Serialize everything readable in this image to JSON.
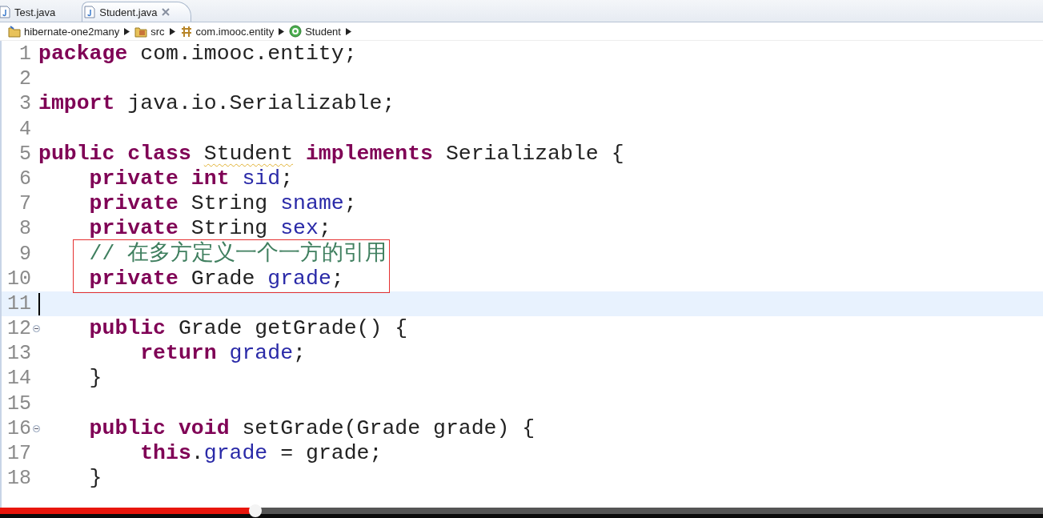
{
  "tabs": [
    {
      "label": "Test.java",
      "selected": false,
      "closable": false
    },
    {
      "label": "Student.java",
      "selected": true,
      "closable": true
    }
  ],
  "breadcrumb": [
    {
      "label": "hibernate-one2many",
      "kind": "project"
    },
    {
      "label": "src",
      "kind": "folder"
    },
    {
      "label": "com.imooc.entity",
      "kind": "package"
    },
    {
      "label": "Student",
      "kind": "class"
    }
  ],
  "code_lines": [
    {
      "number": "1",
      "current": false,
      "boxed": false,
      "fold": false,
      "tokens": [
        {
          "kind": "keyword",
          "text": "package"
        },
        {
          "kind": "plain",
          "text": " com.imooc.entity;"
        }
      ]
    },
    {
      "number": "2",
      "current": false,
      "boxed": false,
      "fold": false
    },
    {
      "number": "3",
      "current": false,
      "boxed": false,
      "fold": false,
      "tokens": [
        {
          "kind": "keyword",
          "text": "import"
        },
        {
          "kind": "plain",
          "text": " java.io.Serializable;"
        }
      ]
    },
    {
      "number": "4",
      "current": false,
      "boxed": false,
      "fold": false
    },
    {
      "number": "5",
      "current": false,
      "boxed": false,
      "fold": false,
      "tokens": [
        {
          "kind": "keyword",
          "text": "public class "
        },
        {
          "kind": "warning",
          "text": "Student"
        },
        {
          "kind": "keyword",
          "text": " implements"
        },
        {
          "kind": "plain",
          "text": " Serializable {"
        }
      ]
    },
    {
      "number": "6",
      "current": false,
      "boxed": false,
      "fold": false,
      "tokens": [
        {
          "kind": "keyword",
          "text": "    private int "
        },
        {
          "kind": "field",
          "text": "sid"
        },
        {
          "kind": "plain",
          "text": ";"
        }
      ]
    },
    {
      "number": "7",
      "current": false,
      "boxed": false,
      "fold": false,
      "tokens": [
        {
          "kind": "keyword",
          "text": "    private"
        },
        {
          "kind": "plain",
          "text": " String "
        },
        {
          "kind": "field",
          "text": "sname"
        },
        {
          "kind": "plain",
          "text": ";"
        }
      ]
    },
    {
      "number": "8",
      "current": false,
      "boxed": false,
      "fold": false,
      "tokens": [
        {
          "kind": "keyword",
          "text": "    private"
        },
        {
          "kind": "plain",
          "text": " String "
        },
        {
          "kind": "field",
          "text": "sex"
        },
        {
          "kind": "plain",
          "text": ";"
        }
      ]
    },
    {
      "number": "9",
      "current": false,
      "boxed": true,
      "fold": false,
      "tokens": [
        {
          "kind": "comment",
          "text": "    // 在多方定义一个一方的引用"
        }
      ]
    },
    {
      "number": "10",
      "current": false,
      "boxed": true,
      "fold": false,
      "tokens": [
        {
          "kind": "keyword",
          "text": "    private"
        },
        {
          "kind": "plain",
          "text": " Grade "
        },
        {
          "kind": "field",
          "text": "grade"
        },
        {
          "kind": "plain",
          "text": ";"
        }
      ]
    },
    {
      "number": "11",
      "current": true,
      "boxed": false,
      "fold": false
    },
    {
      "number": "12",
      "current": false,
      "boxed": false,
      "fold": true,
      "tokens": [
        {
          "kind": "keyword",
          "text": "    public"
        },
        {
          "kind": "plain",
          "text": " Grade getGrade() {"
        }
      ]
    },
    {
      "number": "13",
      "current": false,
      "boxed": false,
      "fold": false,
      "tokens": [
        {
          "kind": "keyword",
          "text": "        return "
        },
        {
          "kind": "field",
          "text": "grade"
        },
        {
          "kind": "plain",
          "text": ";"
        }
      ]
    },
    {
      "number": "14",
      "current": false,
      "boxed": false,
      "fold": false,
      "tokens": [
        {
          "kind": "plain",
          "text": "    }"
        }
      ]
    },
    {
      "number": "15",
      "current": false,
      "boxed": false,
      "fold": false
    },
    {
      "number": "16",
      "current": false,
      "boxed": false,
      "fold": true,
      "tokens": [
        {
          "kind": "keyword",
          "text": "    public void"
        },
        {
          "kind": "plain",
          "text": " setGrade(Grade grade) {"
        }
      ]
    },
    {
      "number": "17",
      "current": false,
      "boxed": false,
      "fold": false,
      "tokens": [
        {
          "kind": "keyword",
          "text": "        this"
        },
        {
          "kind": "plain",
          "text": "."
        },
        {
          "kind": "field",
          "text": "grade"
        },
        {
          "kind": "plain",
          "text": " = grade;"
        }
      ]
    },
    {
      "number": "18",
      "current": false,
      "boxed": false,
      "fold": false,
      "tokens": [
        {
          "kind": "plain",
          "text": "    }"
        }
      ]
    }
  ],
  "video_progress": {
    "level": 0.245
  }
}
